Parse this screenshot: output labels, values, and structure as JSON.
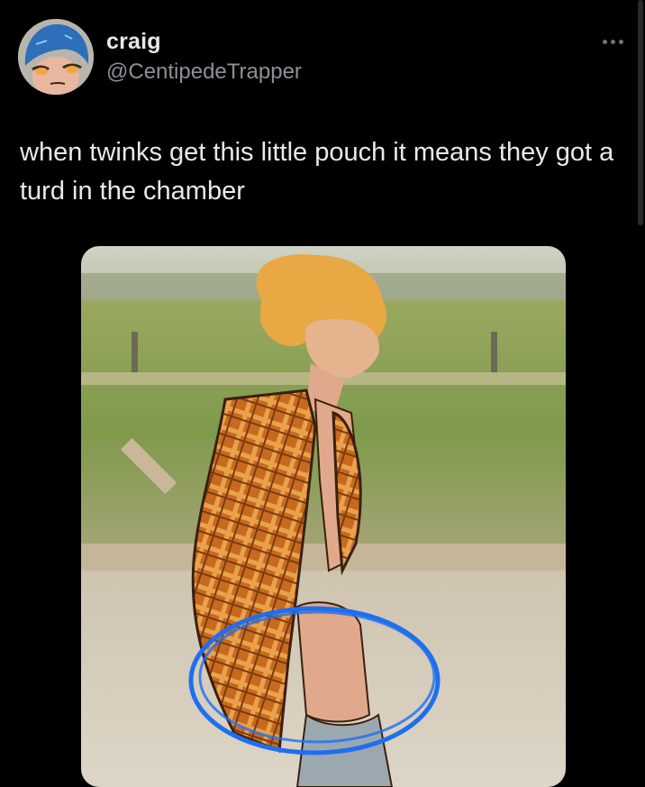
{
  "tweet": {
    "author": {
      "display_name": "craig",
      "handle": "@CentipedeTrapper",
      "avatar_icon": "cartoon-avatar-icon"
    },
    "more_icon": "more-horizontal-icon",
    "text": "when twinks get this little pouch it means they got a turd in the chamber",
    "media": {
      "description_icon": "drawn-character-photo"
    }
  },
  "colors": {
    "background": "#000000",
    "primary_text": "#e7e9ea",
    "secondary_text": "#8b9096",
    "annotation_circle": "#1e6ff0"
  }
}
